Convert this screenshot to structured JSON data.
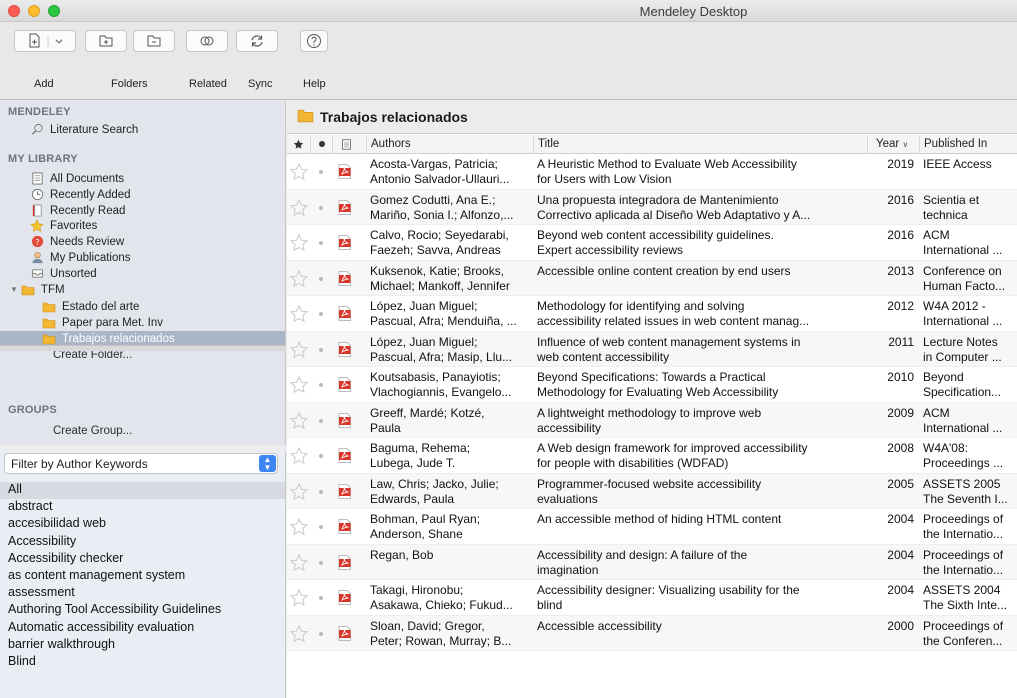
{
  "window": {
    "title": "Mendeley Desktop"
  },
  "toolbar": {
    "add_label": "Add",
    "folders_label": "Folders",
    "related_label": "Related",
    "sync_label": "Sync",
    "help_label": "Help"
  },
  "sidebar": {
    "mendeley_header": "MENDELEY",
    "literature_search": "Literature Search",
    "my_library_header": "MY LIBRARY",
    "library_items": [
      {
        "label": "All Documents",
        "icon": "all-documents-icon"
      },
      {
        "label": "Recently Added",
        "icon": "clock-icon"
      },
      {
        "label": "Recently Read",
        "icon": "book-icon"
      },
      {
        "label": "Favorites",
        "icon": "star-icon"
      },
      {
        "label": "Needs Review",
        "icon": "question-icon"
      },
      {
        "label": "My Publications",
        "icon": "person-icon"
      },
      {
        "label": "Unsorted",
        "icon": "inbox-icon"
      }
    ],
    "tfm_folder": "TFM",
    "subfolders": [
      "Estado del arte",
      "Paper para Met. Inv",
      "Trabajos relacionados"
    ],
    "create_folder": "Create Folder...",
    "groups_header": "GROUPS",
    "create_group": "Create Group..."
  },
  "filter": {
    "selected": "Filter by Author Keywords",
    "keywords": [
      "All",
      "abstract",
      "accesibilidad web",
      "Accessibility",
      "Accessibility checker",
      "as content management system",
      "assessment",
      "Authoring Tool Accessibility Guidelines",
      "Automatic accessibility evaluation",
      "barrier walkthrough",
      "Blind"
    ]
  },
  "main": {
    "folder_title": "Trabajos relacionados",
    "columns": {
      "authors": "Authors",
      "title": "Title",
      "year": "Year",
      "published": "Published In"
    },
    "rows": [
      {
        "a1": "Acosta-Vargas, Patricia;",
        "a2": "Antonio Salvador-Ullauri...",
        "t1": "A Heuristic Method to Evaluate Web Accessibility",
        "t2": "for Users with Low Vision",
        "year": "2019",
        "p1": "IEEE Access",
        "p2": ""
      },
      {
        "a1": "Gomez Codutti, Ana E.;",
        "a2": "Mariño, Sonia I.; Alfonzo,...",
        "t1": "Una propuesta integradora de Mantenimiento",
        "t2": "Correctivo aplicada al Diseño Web Adaptativo y A...",
        "year": "2016",
        "p1": "Scientia et",
        "p2": "technica"
      },
      {
        "a1": "Calvo, Rocio; Seyedarabi,",
        "a2": "Faezeh; Savva, Andreas",
        "t1": "Beyond web content accessibility guidelines.",
        "t2": "Expert accessibility reviews",
        "year": "2016",
        "p1": "ACM",
        "p2": "International ..."
      },
      {
        "a1": "Kuksenok, Katie; Brooks,",
        "a2": "Michael; Mankoff, Jennifer",
        "t1": "Accessible online content creation by end users",
        "t2": "",
        "year": "2013",
        "p1": "Conference on",
        "p2": "Human Facto..."
      },
      {
        "a1": "López, Juan Miguel;",
        "a2": "Pascual, Afra; Menduiña, ...",
        "t1": "Methodology for identifying and solving",
        "t2": "accessibility related issues in web content manag...",
        "year": "2012",
        "p1": "W4A 2012 -",
        "p2": "International ..."
      },
      {
        "a1": "López, Juan Miguel;",
        "a2": "Pascual, Afra; Masip, Llu...",
        "t1": "Influence of web content management systems in",
        "t2": "web content accessibility",
        "year": "2011",
        "p1": "Lecture Notes",
        "p2": "in Computer ..."
      },
      {
        "a1": "Koutsabasis, Panayiotis;",
        "a2": "Vlachogiannis, Evangelo...",
        "t1": "Beyond Specifications: Towards a Practical",
        "t2": "Methodology for Evaluating Web Accessibility",
        "year": "2010",
        "p1": "Beyond",
        "p2": "Specification..."
      },
      {
        "a1": "Greeff, Mardé; Kotzé,",
        "a2": "Paula",
        "t1": "A lightweight methodology to improve web",
        "t2": "accessibility",
        "year": "2009",
        "p1": "ACM",
        "p2": "International ..."
      },
      {
        "a1": "Baguma, Rehema;",
        "a2": "Lubega, Jude T.",
        "t1": "A Web design framework for improved accessibility",
        "t2": "for people with disabilities (WDFAD)",
        "year": "2008",
        "p1": "W4A'08:",
        "p2": "Proceedings ..."
      },
      {
        "a1": "Law, Chris; Jacko, Julie;",
        "a2": "Edwards, Paula",
        "t1": "Programmer-focused website accessibility",
        "t2": "evaluations",
        "year": "2005",
        "p1": "ASSETS 2005",
        "p2": "The Seventh I..."
      },
      {
        "a1": "Bohman, Paul Ryan;",
        "a2": "Anderson, Shane",
        "t1": "An accessible method of hiding HTML content",
        "t2": "",
        "year": "2004",
        "p1": "Proceedings of",
        "p2": "the Internatio..."
      },
      {
        "a1": "Regan, Bob",
        "a2": "",
        "t1": "Accessibility and design: A failure of the",
        "t2": "imagination",
        "year": "2004",
        "p1": "Proceedings of",
        "p2": "the Internatio..."
      },
      {
        "a1": "Takagi, Hironobu;",
        "a2": "Asakawa, Chieko; Fukud...",
        "t1": "Accessibility designer: Visualizing usability for the",
        "t2": "blind",
        "year": "2004",
        "p1": "ASSETS 2004",
        "p2": "The Sixth Inte..."
      },
      {
        "a1": "Sloan, David; Gregor,",
        "a2": "Peter; Rowan, Murray; B...",
        "t1": "Accessible accessibility",
        "t2": "",
        "year": "2000",
        "p1": "Proceedings of",
        "p2": "the Conferen..."
      }
    ]
  },
  "colors": {
    "accent": "#3d84f5",
    "selection": "#a8b6c8",
    "folder": "#f2b632",
    "pdf": "#d9362b"
  }
}
